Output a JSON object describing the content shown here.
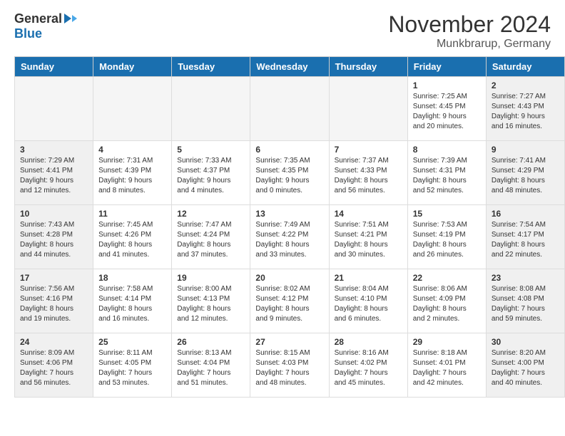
{
  "header": {
    "logo_general": "General",
    "logo_blue": "Blue",
    "month_title": "November 2024",
    "location": "Munkbrarup, Germany"
  },
  "days_of_week": [
    "Sunday",
    "Monday",
    "Tuesday",
    "Wednesday",
    "Thursday",
    "Friday",
    "Saturday"
  ],
  "weeks": [
    {
      "days": [
        {
          "num": "",
          "empty": true
        },
        {
          "num": "",
          "empty": true
        },
        {
          "num": "",
          "empty": true
        },
        {
          "num": "",
          "empty": true
        },
        {
          "num": "",
          "empty": true
        },
        {
          "num": "1",
          "info": "Sunrise: 7:25 AM\nSunset: 4:45 PM\nDaylight: 9 hours\nand 20 minutes."
        },
        {
          "num": "2",
          "info": "Sunrise: 7:27 AM\nSunset: 4:43 PM\nDaylight: 9 hours\nand 16 minutes."
        }
      ]
    },
    {
      "days": [
        {
          "num": "3",
          "info": "Sunrise: 7:29 AM\nSunset: 4:41 PM\nDaylight: 9 hours\nand 12 minutes."
        },
        {
          "num": "4",
          "info": "Sunrise: 7:31 AM\nSunset: 4:39 PM\nDaylight: 9 hours\nand 8 minutes."
        },
        {
          "num": "5",
          "info": "Sunrise: 7:33 AM\nSunset: 4:37 PM\nDaylight: 9 hours\nand 4 minutes."
        },
        {
          "num": "6",
          "info": "Sunrise: 7:35 AM\nSunset: 4:35 PM\nDaylight: 9 hours\nand 0 minutes."
        },
        {
          "num": "7",
          "info": "Sunrise: 7:37 AM\nSunset: 4:33 PM\nDaylight: 8 hours\nand 56 minutes."
        },
        {
          "num": "8",
          "info": "Sunrise: 7:39 AM\nSunset: 4:31 PM\nDaylight: 8 hours\nand 52 minutes."
        },
        {
          "num": "9",
          "info": "Sunrise: 7:41 AM\nSunset: 4:29 PM\nDaylight: 8 hours\nand 48 minutes."
        }
      ]
    },
    {
      "days": [
        {
          "num": "10",
          "info": "Sunrise: 7:43 AM\nSunset: 4:28 PM\nDaylight: 8 hours\nand 44 minutes."
        },
        {
          "num": "11",
          "info": "Sunrise: 7:45 AM\nSunset: 4:26 PM\nDaylight: 8 hours\nand 41 minutes."
        },
        {
          "num": "12",
          "info": "Sunrise: 7:47 AM\nSunset: 4:24 PM\nDaylight: 8 hours\nand 37 minutes."
        },
        {
          "num": "13",
          "info": "Sunrise: 7:49 AM\nSunset: 4:22 PM\nDaylight: 8 hours\nand 33 minutes."
        },
        {
          "num": "14",
          "info": "Sunrise: 7:51 AM\nSunset: 4:21 PM\nDaylight: 8 hours\nand 30 minutes."
        },
        {
          "num": "15",
          "info": "Sunrise: 7:53 AM\nSunset: 4:19 PM\nDaylight: 8 hours\nand 26 minutes."
        },
        {
          "num": "16",
          "info": "Sunrise: 7:54 AM\nSunset: 4:17 PM\nDaylight: 8 hours\nand 22 minutes."
        }
      ]
    },
    {
      "days": [
        {
          "num": "17",
          "info": "Sunrise: 7:56 AM\nSunset: 4:16 PM\nDaylight: 8 hours\nand 19 minutes."
        },
        {
          "num": "18",
          "info": "Sunrise: 7:58 AM\nSunset: 4:14 PM\nDaylight: 8 hours\nand 16 minutes."
        },
        {
          "num": "19",
          "info": "Sunrise: 8:00 AM\nSunset: 4:13 PM\nDaylight: 8 hours\nand 12 minutes."
        },
        {
          "num": "20",
          "info": "Sunrise: 8:02 AM\nSunset: 4:12 PM\nDaylight: 8 hours\nand 9 minutes."
        },
        {
          "num": "21",
          "info": "Sunrise: 8:04 AM\nSunset: 4:10 PM\nDaylight: 8 hours\nand 6 minutes."
        },
        {
          "num": "22",
          "info": "Sunrise: 8:06 AM\nSunset: 4:09 PM\nDaylight: 8 hours\nand 2 minutes."
        },
        {
          "num": "23",
          "info": "Sunrise: 8:08 AM\nSunset: 4:08 PM\nDaylight: 7 hours\nand 59 minutes."
        }
      ]
    },
    {
      "days": [
        {
          "num": "24",
          "info": "Sunrise: 8:09 AM\nSunset: 4:06 PM\nDaylight: 7 hours\nand 56 minutes."
        },
        {
          "num": "25",
          "info": "Sunrise: 8:11 AM\nSunset: 4:05 PM\nDaylight: 7 hours\nand 53 minutes."
        },
        {
          "num": "26",
          "info": "Sunrise: 8:13 AM\nSunset: 4:04 PM\nDaylight: 7 hours\nand 51 minutes."
        },
        {
          "num": "27",
          "info": "Sunrise: 8:15 AM\nSunset: 4:03 PM\nDaylight: 7 hours\nand 48 minutes."
        },
        {
          "num": "28",
          "info": "Sunrise: 8:16 AM\nSunset: 4:02 PM\nDaylight: 7 hours\nand 45 minutes."
        },
        {
          "num": "29",
          "info": "Sunrise: 8:18 AM\nSunset: 4:01 PM\nDaylight: 7 hours\nand 42 minutes."
        },
        {
          "num": "30",
          "info": "Sunrise: 8:20 AM\nSunset: 4:00 PM\nDaylight: 7 hours\nand 40 minutes."
        }
      ]
    }
  ]
}
